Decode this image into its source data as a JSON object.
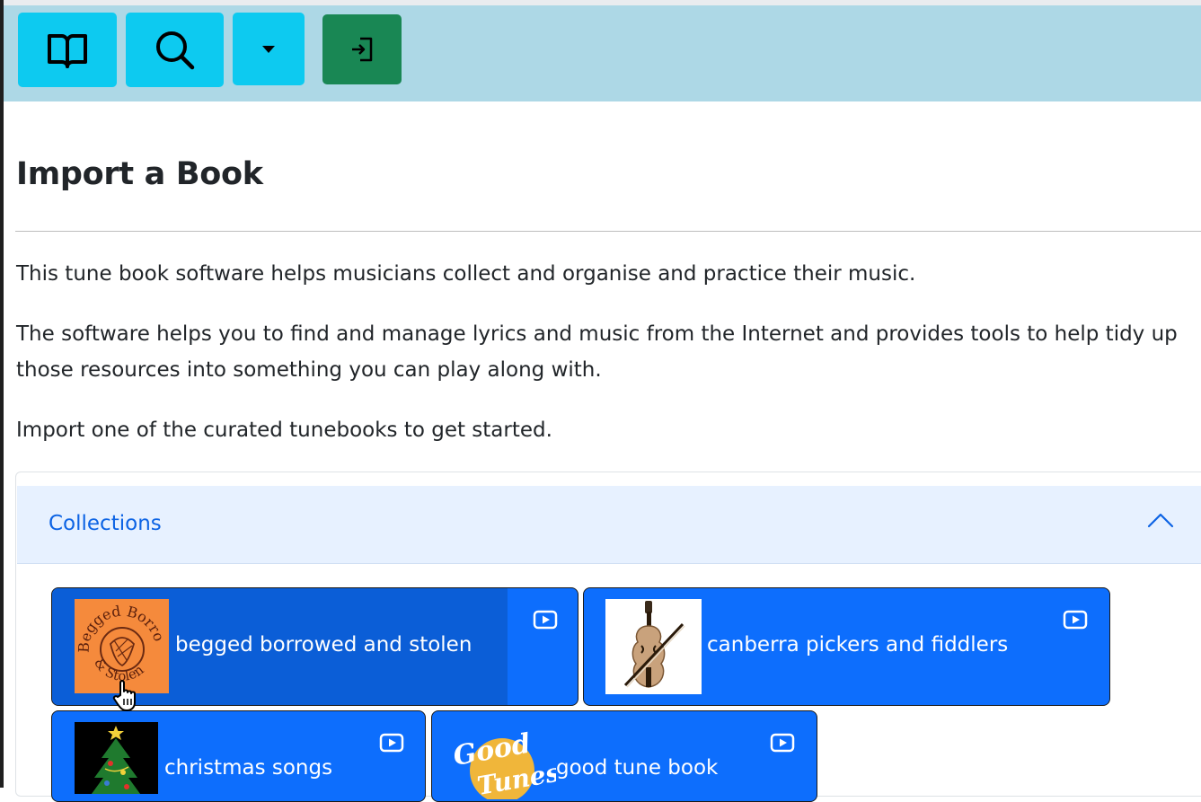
{
  "toolbar": {
    "icons": [
      "book-icon",
      "search-icon",
      "caret-down-icon",
      "login-icon"
    ]
  },
  "page": {
    "title": "Import a Book",
    "paragraphs": [
      "This tune book software helps musicians collect and organise and practice their music.",
      "The software helps you to find and manage lyrics and music from the Internet and provides tools to help tidy up those resources into something you can play along with.",
      "Import one of the curated tunebooks to get started."
    ]
  },
  "collections": {
    "header": "Collections",
    "items": [
      {
        "label": "begged borrowed and stolen",
        "thumb_text": "Begged Borrowed & Stolen",
        "icon": "youtube-play-icon"
      },
      {
        "label": "canberra pickers and fiddlers",
        "icon": "youtube-play-icon"
      },
      {
        "label": "christmas songs",
        "icon": "youtube-play-icon"
      },
      {
        "label": "good tune book",
        "thumb_text": "Good Tunes",
        "icon": "youtube-play-icon"
      }
    ]
  },
  "colors": {
    "toolbar_bg": "#add8e6",
    "info_button": "#0dcaf0",
    "success_button": "#198754",
    "primary": "#0d6efd",
    "accordion_header_bg": "#e7f1ff",
    "accordion_header_text": "#0c63e4"
  }
}
